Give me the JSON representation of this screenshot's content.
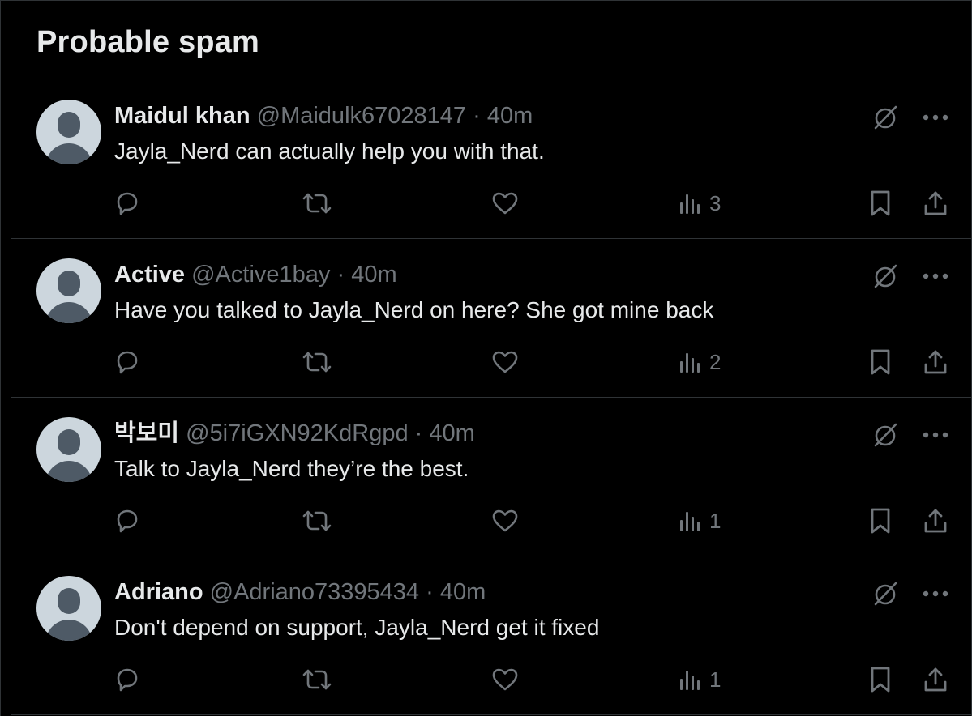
{
  "section": {
    "title": "Probable spam"
  },
  "tweets": [
    {
      "name": "Maidul khan",
      "handle": "@Maidulk67028147",
      "dot": "·",
      "time": "40m",
      "text": "Jayla_Nerd can actually help you with that.",
      "views": "3"
    },
    {
      "name": "Active",
      "handle": "@Active1bay",
      "dot": "·",
      "time": "40m",
      "text": "Have you talked to Jayla_Nerd on here? She got mine back",
      "views": "2"
    },
    {
      "name": "박보미",
      "handle": "@5i7iGXN92KdRgpd",
      "dot": "·",
      "time": "40m",
      "text": "Talk to  Jayla_Nerd they’re the best.",
      "views": "1"
    },
    {
      "name": "Adriano",
      "handle": "@Adriano73395434",
      "dot": "·",
      "time": "40m",
      "text": "Don't depend on support, Jayla_Nerd get it fixed",
      "views": "1"
    }
  ],
  "icons": {
    "grok": "grok-slash-icon",
    "more": "more-icon",
    "reply": "reply-icon",
    "repost": "repost-icon",
    "like": "heart-icon",
    "views": "views-chart-icon",
    "bookmark": "bookmark-icon",
    "share": "share-icon"
  },
  "colors": {
    "background": "#000000",
    "text_primary": "#e7e9ea",
    "text_secondary": "#71767b",
    "divider": "#2f3336",
    "avatar_bg": "#ccd6dd",
    "avatar_fg": "#4e5a66"
  }
}
